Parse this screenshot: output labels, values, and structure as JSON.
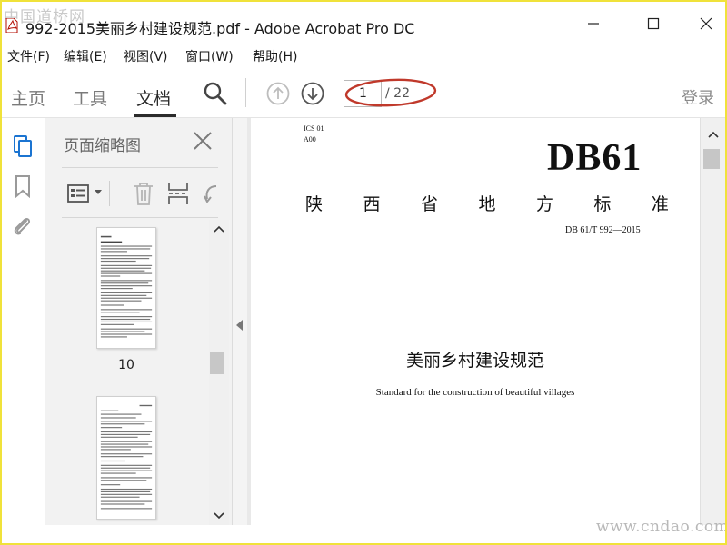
{
  "watermark": {
    "top": "中国道桥网",
    "bottom": "www.cndao.com"
  },
  "window": {
    "title": "992-2015美丽乡村建设规范.pdf - Adobe Acrobat Pro DC",
    "icons": [
      "pdf-file-icon",
      "minimize-icon",
      "maximize-icon",
      "close-icon"
    ]
  },
  "menu": {
    "items": [
      "文件(F)",
      "编辑(E)",
      "视图(V)",
      "窗口(W)",
      "帮助(H)"
    ]
  },
  "toolbar": {
    "tabs": [
      "主页",
      "工具",
      "文档"
    ],
    "active_tab": "文档",
    "current_page": "1",
    "total_pages": "/ 22",
    "login": "登录",
    "annotation_color": "#c0392b"
  },
  "thumbnails_panel": {
    "title": "页面缩略图",
    "pages": [
      {
        "label": "10"
      },
      {
        "label": ""
      }
    ]
  },
  "document": {
    "ics": "ICS 01",
    "a00": "A00",
    "code": "DB61",
    "province_chars": [
      "陕",
      "西",
      "省",
      "地",
      "方",
      "标",
      "准"
    ],
    "standard_number": "DB 61/T 992—2015",
    "title": "美丽乡村建设规范",
    "subtitle": "Standard for the construction of beautiful villages"
  },
  "colors": {
    "frame_border": "#f0e23a",
    "accent_active": "#2b2b2b"
  }
}
